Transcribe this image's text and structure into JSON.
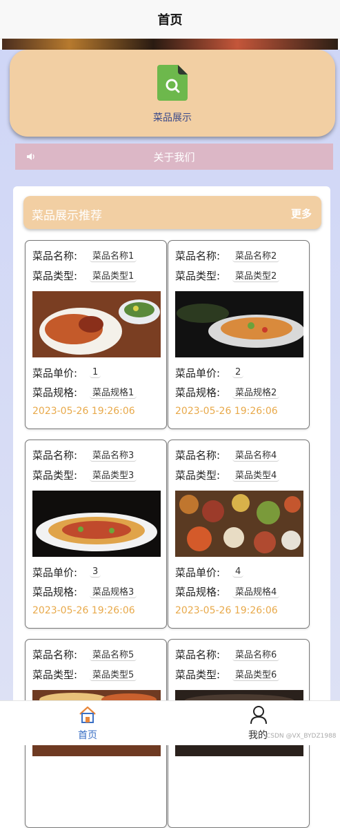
{
  "header": {
    "title": "首页"
  },
  "menu": {
    "label": "菜品展示",
    "icon": "search-document-icon"
  },
  "about": {
    "label": "关于我们",
    "icon": "speaker-icon"
  },
  "recommend": {
    "title": "菜品展示推荐",
    "more": "更多"
  },
  "field_labels": {
    "name": "菜品名称:",
    "type": "菜品类型:",
    "price": "菜品单价:",
    "spec": "菜品规格:"
  },
  "dishes": [
    {
      "name": "菜品名称1",
      "type": "菜品类型1",
      "price": "1",
      "spec": "菜品规格1",
      "time": "2023-05-26 19:26:06"
    },
    {
      "name": "菜品名称2",
      "type": "菜品类型2",
      "price": "2",
      "spec": "菜品规格2",
      "time": "2023-05-26 19:26:06"
    },
    {
      "name": "菜品名称3",
      "type": "菜品类型3",
      "price": "3",
      "spec": "菜品规格3",
      "time": "2023-05-26 19:26:06"
    },
    {
      "name": "菜品名称4",
      "type": "菜品类型4",
      "price": "4",
      "spec": "菜品规格4",
      "time": "2023-05-26 19:26:06"
    },
    {
      "name": "菜品名称5",
      "type": "菜品类型5"
    },
    {
      "name": "菜品名称6",
      "type": "菜品类型6"
    }
  ],
  "tabbar": {
    "home": {
      "label": "首页",
      "icon": "home-icon"
    },
    "me": {
      "label": "我的",
      "icon": "user-icon"
    }
  },
  "watermark": "CSDN @VX_BYDZ1988",
  "colors": {
    "accent": "#3a6fc4",
    "card": "#f2cfa3",
    "about": "#dcb7c6",
    "time": "#e8a94a"
  }
}
